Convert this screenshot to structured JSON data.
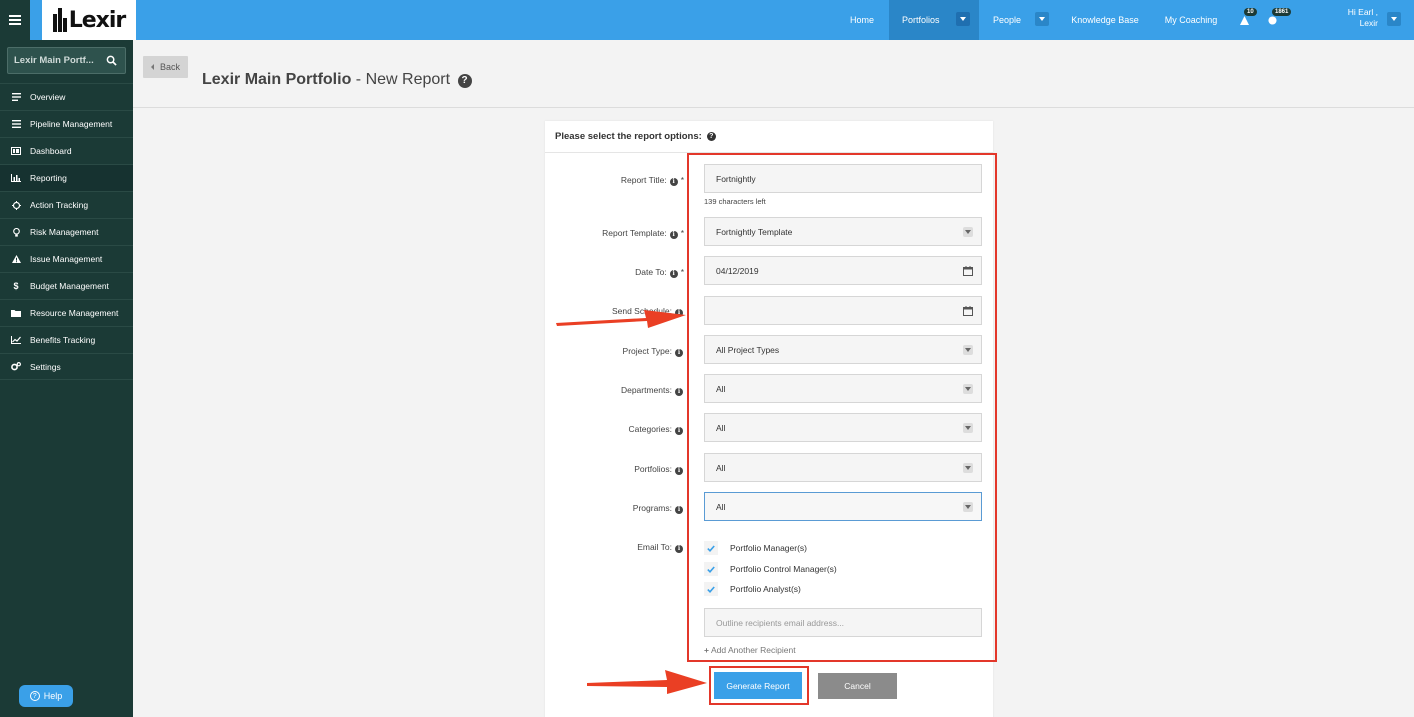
{
  "brand": {
    "logo_text": "Lexir",
    "accent": "#3aa0e8",
    "sidebar_bg": "#1b3a36",
    "highlight": "#e3372a"
  },
  "topnav": {
    "home": "Home",
    "portfolios": "Portfolios",
    "people": "People",
    "knowledge_base": "Knowledge Base",
    "my_coaching": "My Coaching",
    "alerts_count": "10",
    "points_count": "1861",
    "greeting_line1": "Hi Earl ,",
    "greeting_line2": "Lexir"
  },
  "sidebar": {
    "search_value": "Lexir Main Portf...",
    "items": [
      {
        "label": "Overview",
        "icon": "list-icon"
      },
      {
        "label": "Pipeline Management",
        "icon": "pipeline-icon"
      },
      {
        "label": "Dashboard",
        "icon": "dashboard-icon"
      },
      {
        "label": "Reporting",
        "icon": "bar-chart-icon"
      },
      {
        "label": "Action Tracking",
        "icon": "crosshair-icon"
      },
      {
        "label": "Risk Management",
        "icon": "lightbulb-icon"
      },
      {
        "label": "Issue Management",
        "icon": "warning-icon"
      },
      {
        "label": "Budget Management",
        "icon": "dollar-icon"
      },
      {
        "label": "Resource Management",
        "icon": "folder-icon"
      },
      {
        "label": "Benefits Tracking",
        "icon": "line-chart-icon"
      },
      {
        "label": "Settings",
        "icon": "gears-icon"
      }
    ],
    "help_label": "Help"
  },
  "page": {
    "back_label": "Back",
    "title_bold": "Lexir Main Portfolio",
    "title_rest": " - New Report"
  },
  "form": {
    "heading": "Please select the report options:",
    "report_title": {
      "label": "Report Title:",
      "value": "Fortnightly",
      "chars_left": "139 characters left"
    },
    "report_template": {
      "label": "Report Template:",
      "value": "Fortnightly Template"
    },
    "date_to": {
      "label": "Date To:",
      "value": "04/12/2019"
    },
    "send_schedule": {
      "label": "Send Schedule:",
      "value": ""
    },
    "project_type": {
      "label": "Project Type:",
      "value": "All Project Types"
    },
    "departments": {
      "label": "Departments:",
      "value": "All"
    },
    "categories": {
      "label": "Categories:",
      "value": "All"
    },
    "portfolios": {
      "label": "Portfolios:",
      "value": "All"
    },
    "programs": {
      "label": "Programs:",
      "value": "All"
    },
    "email_to": {
      "label": "Email To:",
      "options": [
        "Portfolio Manager(s)",
        "Portfolio Control Manager(s)",
        "Portfolio Analyst(s)"
      ],
      "recipient_placeholder": "Outline recipients email address...",
      "add_recipient": "Add Another Recipient"
    },
    "required_mark": "*",
    "generate_label": "Generate Report",
    "cancel_label": "Cancel"
  }
}
